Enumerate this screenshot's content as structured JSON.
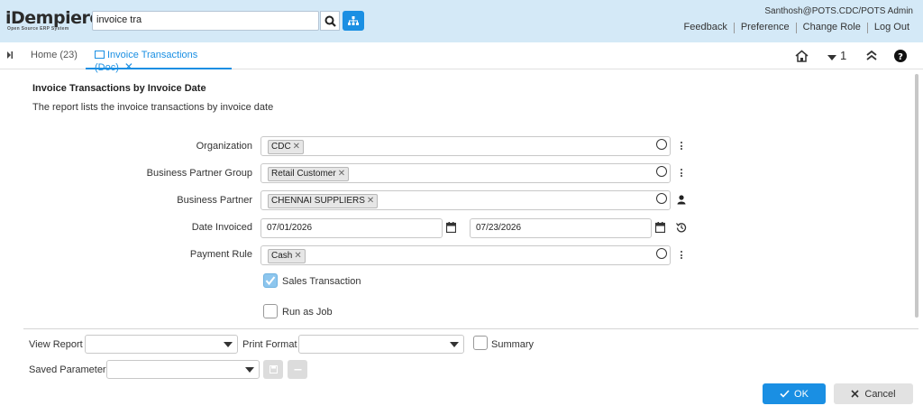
{
  "header": {
    "logo_main": "iDempiere",
    "logo_sub": "Open Source ERP System",
    "search_value": "invoice tra",
    "user": "Santhosh@POTS.CDC/POTS Admin",
    "links": [
      "Feedback",
      "Preference",
      "Change Role",
      "Log Out"
    ]
  },
  "tabs": {
    "home": "Home (23)",
    "active": "Invoice Transactions (Doc)",
    "window_count": "1"
  },
  "report": {
    "title": "Invoice Transactions by Invoice Date",
    "description": "The report lists the invoice transactions by invoice date"
  },
  "fields": {
    "organization": {
      "label": "Organization",
      "value": "CDC"
    },
    "bp_group": {
      "label": "Business Partner Group",
      "value": "Retail Customer"
    },
    "bp": {
      "label": "Business Partner",
      "value": "CHENNAI SUPPLIERS"
    },
    "date_invoiced": {
      "label": "Date Invoiced",
      "from": "07/01/2026",
      "to": "07/23/2026"
    },
    "payment_rule": {
      "label": "Payment Rule",
      "value": "Cash"
    },
    "sales_transaction": {
      "label": "Sales Transaction",
      "checked": true
    },
    "run_as_job": {
      "label": "Run as Job",
      "checked": false
    }
  },
  "bottom": {
    "view_report": "View Report",
    "print_format": "Print Format",
    "summary": "Summary",
    "saved_parameters": "Saved Parameters",
    "ok": "OK",
    "cancel": "Cancel"
  },
  "colors": {
    "accent": "#1a8fe3",
    "header_bg": "#d4e9f7",
    "checkbox_checked": "#8dc6ee"
  }
}
